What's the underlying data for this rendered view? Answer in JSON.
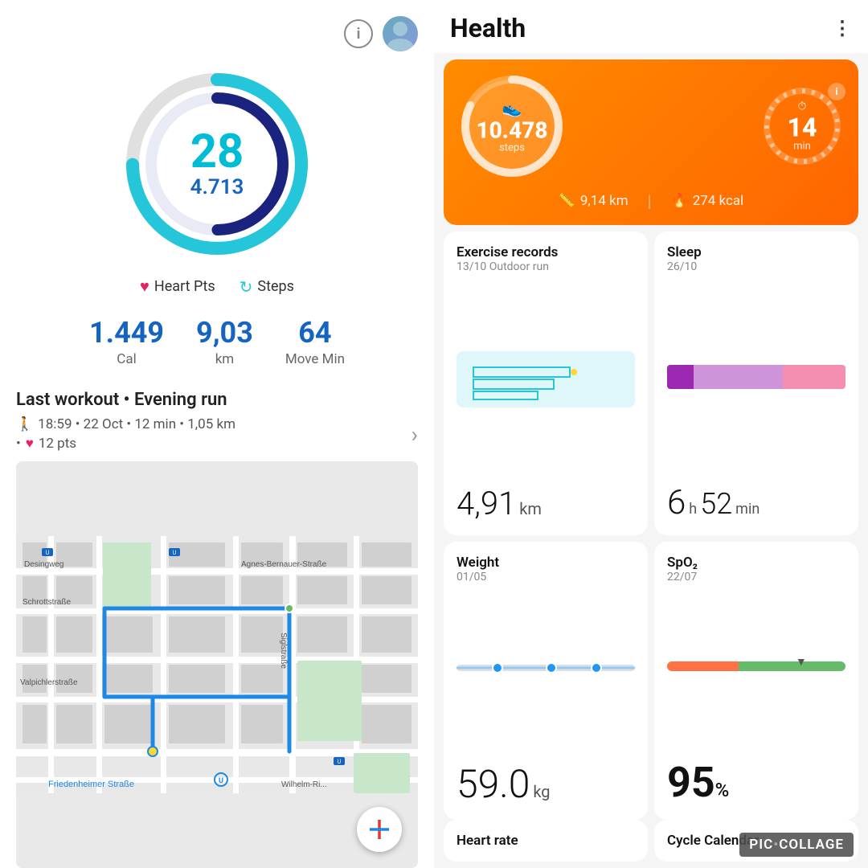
{
  "left": {
    "ring": {
      "main_value": "28",
      "sub_value": "4.713"
    },
    "legend": {
      "heart_pts": "Heart Pts",
      "steps": "Steps"
    },
    "stats": [
      {
        "value": "1.449",
        "label": "Cal"
      },
      {
        "value": "9,03",
        "label": "km"
      },
      {
        "value": "64",
        "label": "Move Min"
      }
    ],
    "workout": {
      "title": "Last workout • Evening run",
      "time": "18:59 • 22 Oct • 12 min • 1,05 km",
      "pts": "12 pts"
    },
    "map": {
      "labels": [
        "Desingweg",
        "Schrottstraße",
        "Agnes-Bernauer-Straße",
        "Valpichlerstraße",
        "Siglstraße",
        "Friedenheimer Straße",
        "Wilhelm-Ri..."
      ]
    }
  },
  "right": {
    "header": {
      "title": "Health",
      "more_label": "⋮"
    },
    "banner": {
      "steps_value": "10.478",
      "steps_label": "steps",
      "timer_value": "14",
      "timer_label": "min",
      "distance": "9,14 km",
      "calories": "274 kcal"
    },
    "cards": [
      {
        "title": "Exercise records",
        "date": "13/10 Outdoor run",
        "value": "4,91",
        "unit": "km",
        "type": "exercise"
      },
      {
        "title": "Sleep",
        "date": "26/10",
        "value": "6",
        "value2": "52",
        "unit": "h",
        "unit2": "min",
        "type": "sleep"
      },
      {
        "title": "Weight",
        "date": "01/05",
        "value": "59.0",
        "unit": "kg",
        "type": "weight"
      },
      {
        "title": "SpO₂",
        "date": "22/07",
        "value": "95",
        "unit": "%",
        "type": "spo2"
      }
    ],
    "bottom": [
      {
        "title": "Heart rate",
        "type": "heart"
      },
      {
        "title": "Cycle Calendar",
        "type": "cycle"
      }
    ]
  }
}
